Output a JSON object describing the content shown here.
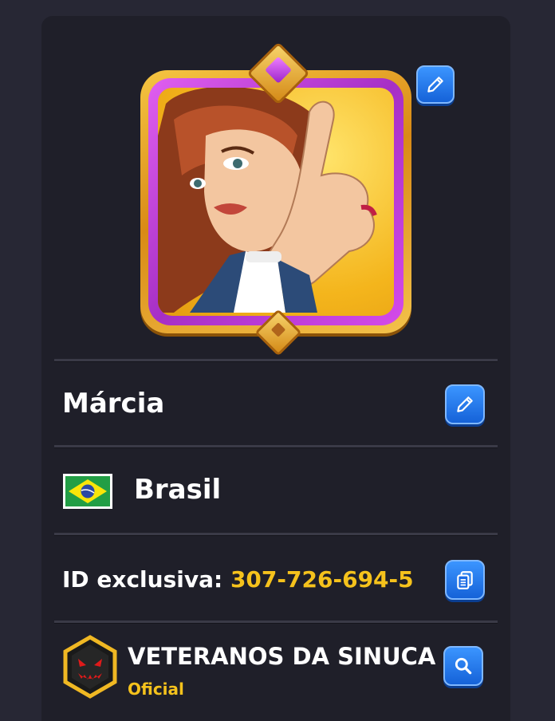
{
  "profile": {
    "name": "Márcia",
    "country": "Brasil",
    "id_label": "ID exclusiva:",
    "id_value": "307-726-694-5"
  },
  "club": {
    "name": "VETERANOS DA SINUCA",
    "status": "Oficial"
  },
  "icons": {
    "avatar_edit": "pencil-icon",
    "name_edit": "pencil-icon",
    "copy_id": "copy-icon",
    "club_search": "search-icon",
    "flag": "brazil-flag-icon",
    "club_badge": "club-badge-icon"
  },
  "colors": {
    "accent_gold": "#f5c21c",
    "button_blue": "#1f78f0",
    "panel_bg": "#1f1f29",
    "page_bg": "#272734"
  }
}
